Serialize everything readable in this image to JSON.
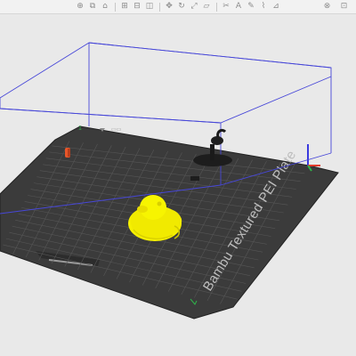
{
  "toolbar": {
    "tools": [
      {
        "name": "add-object-icon",
        "glyph": "⊕"
      },
      {
        "name": "copy-icon",
        "glyph": "⧉"
      },
      {
        "name": "home-icon",
        "glyph": "⌂"
      },
      {
        "name": "grid-icon",
        "glyph": "⊞"
      },
      {
        "name": "arrange-icon",
        "glyph": "⊟"
      },
      {
        "name": "orient-icon",
        "glyph": "◫"
      },
      {
        "name": "move-icon",
        "glyph": "✥"
      },
      {
        "name": "rotate-icon",
        "glyph": "↻"
      },
      {
        "name": "scale-icon",
        "glyph": "⤢"
      },
      {
        "name": "lay-on-face-icon",
        "glyph": "▱"
      },
      {
        "name": "cut-icon",
        "glyph": "✂"
      },
      {
        "name": "text-icon",
        "glyph": "A"
      },
      {
        "name": "paint-icon",
        "glyph": "✎"
      },
      {
        "name": "seam-icon",
        "glyph": "⌇"
      },
      {
        "name": "measure-icon",
        "glyph": "⊿"
      }
    ],
    "right_tools": [
      {
        "name": "assembly-icon",
        "glyph": "⊗"
      },
      {
        "name": "view-icon",
        "glyph": "⊡"
      }
    ]
  },
  "plate": {
    "label": "Bambu Textured PEI Plate",
    "number": "1"
  },
  "colors": {
    "bed": "#3a3a3a",
    "grid": "#5a5a5a",
    "duck": "#f5f000",
    "bounding_box": "#3f3fd6",
    "object_orange": "#e8562a"
  }
}
